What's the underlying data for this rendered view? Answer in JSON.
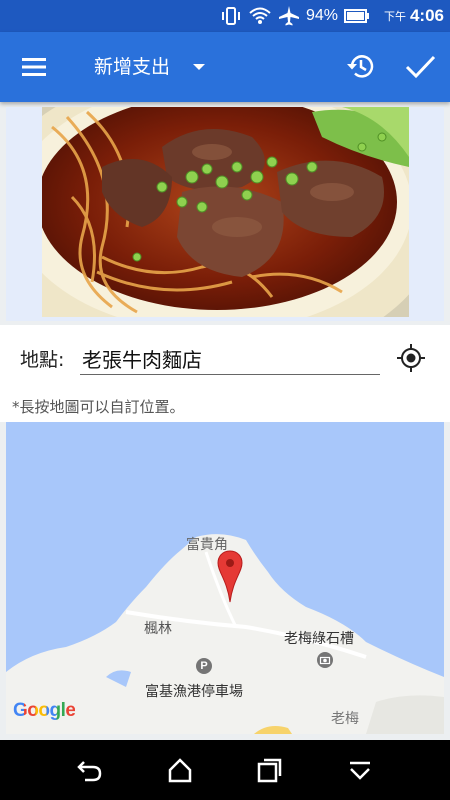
{
  "status_bar": {
    "battery_percent": "94%",
    "ampm": "下午",
    "time": "4:06",
    "icons": [
      "vibrate-icon",
      "wifi-icon",
      "airplane-icon",
      "battery-icon"
    ]
  },
  "toolbar": {
    "title": "新增支出",
    "icons": [
      "menu-icon",
      "dropdown-arrow-icon",
      "history-icon",
      "check-icon"
    ]
  },
  "photo": {
    "description_icon": "beef-noodle-photo"
  },
  "location": {
    "label": "地點:",
    "value": "老張牛肉麵店",
    "icon": "gps-target-icon"
  },
  "hint": "*長按地圖可以自訂位置。",
  "map": {
    "labels": {
      "cape": "富貴角",
      "maple": "楓林",
      "parking": "富基漁港停車場",
      "stone_weir": "老梅綠石槽",
      "laomei": "老梅"
    },
    "logo": "Google",
    "colors": {
      "water": "#a8c7fa",
      "land": "#f2f2ef",
      "pin": "#e53935"
    }
  },
  "nav_bar": {
    "icons": [
      "back-icon",
      "home-icon",
      "recents-icon",
      "hide-keyboard-icon"
    ]
  },
  "colors": {
    "status_bar": "#1e59c0",
    "toolbar": "#2a71db"
  }
}
